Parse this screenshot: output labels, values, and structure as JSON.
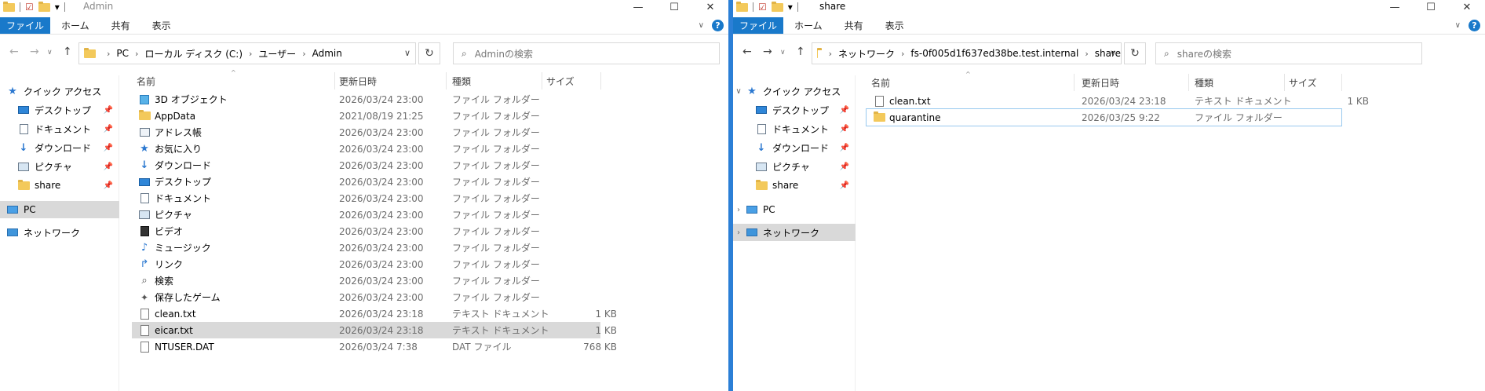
{
  "left": {
    "title": "Admin",
    "ribbon": {
      "file": "ファイル",
      "home": "ホーム",
      "share": "共有",
      "view": "表示"
    },
    "address": [
      "PC",
      "ローカル ディスク (C:)",
      "ユーザー",
      "Admin"
    ],
    "search_placeholder": "Adminの検索",
    "nav": [
      {
        "label": "クイック アクセス",
        "icon": "star-icon"
      },
      {
        "label": "デスクトップ",
        "icon": "desktop-icon",
        "pinned": true
      },
      {
        "label": "ドキュメント",
        "icon": "document-icon",
        "pinned": true
      },
      {
        "label": "ダウンロード",
        "icon": "download-icon",
        "pinned": true
      },
      {
        "label": "ピクチャ",
        "icon": "picture-icon",
        "pinned": true
      },
      {
        "label": "share",
        "icon": "folder-icon",
        "pinned": true
      },
      {
        "label": "PC",
        "icon": "pc-icon",
        "selected": true
      },
      {
        "label": "ネットワーク",
        "icon": "network-icon"
      }
    ],
    "columns": {
      "name": "名前",
      "date": "更新日時",
      "type": "種類",
      "size": "サイズ"
    },
    "files": [
      {
        "name": "3D オブジェクト",
        "date": "2026/03/24 23:00",
        "type": "ファイル フォルダー",
        "size": "",
        "icon": "cube-icon"
      },
      {
        "name": "AppData",
        "date": "2021/08/19 21:25",
        "type": "ファイル フォルダー",
        "size": "",
        "icon": "folder-icon"
      },
      {
        "name": "アドレス帳",
        "date": "2026/03/24 23:00",
        "type": "ファイル フォルダー",
        "size": "",
        "icon": "contacts-icon"
      },
      {
        "name": "お気に入り",
        "date": "2026/03/24 23:00",
        "type": "ファイル フォルダー",
        "size": "",
        "icon": "star-icon"
      },
      {
        "name": "ダウンロード",
        "date": "2026/03/24 23:00",
        "type": "ファイル フォルダー",
        "size": "",
        "icon": "download-icon"
      },
      {
        "name": "デスクトップ",
        "date": "2026/03/24 23:00",
        "type": "ファイル フォルダー",
        "size": "",
        "icon": "desktop-icon"
      },
      {
        "name": "ドキュメント",
        "date": "2026/03/24 23:00",
        "type": "ファイル フォルダー",
        "size": "",
        "icon": "document-icon"
      },
      {
        "name": "ピクチャ",
        "date": "2026/03/24 23:00",
        "type": "ファイル フォルダー",
        "size": "",
        "icon": "picture-icon"
      },
      {
        "name": "ビデオ",
        "date": "2026/03/24 23:00",
        "type": "ファイル フォルダー",
        "size": "",
        "icon": "video-icon"
      },
      {
        "name": "ミュージック",
        "date": "2026/03/24 23:00",
        "type": "ファイル フォルダー",
        "size": "",
        "icon": "music-icon"
      },
      {
        "name": "リンク",
        "date": "2026/03/24 23:00",
        "type": "ファイル フォルダー",
        "size": "",
        "icon": "link-icon"
      },
      {
        "name": "検索",
        "date": "2026/03/24 23:00",
        "type": "ファイル フォルダー",
        "size": "",
        "icon": "search-icon"
      },
      {
        "name": "保存したゲーム",
        "date": "2026/03/24 23:00",
        "type": "ファイル フォルダー",
        "size": "",
        "icon": "game-icon"
      },
      {
        "name": "clean.txt",
        "date": "2026/03/24 23:18",
        "type": "テキスト ドキュメント",
        "size": "1 KB",
        "icon": "text-file-icon"
      },
      {
        "name": "eicar.txt",
        "date": "2026/03/24 23:18",
        "type": "テキスト ドキュメント",
        "size": "1 KB",
        "icon": "text-file-icon",
        "selected": true
      },
      {
        "name": "NTUSER.DAT",
        "date": "2026/03/24 7:38",
        "type": "DAT ファイル",
        "size": "768 KB",
        "icon": "file-icon"
      }
    ]
  },
  "right": {
    "title": "share",
    "ribbon": {
      "file": "ファイル",
      "home": "ホーム",
      "share": "共有",
      "view": "表示"
    },
    "address": [
      "ネットワーク",
      "fs-0f005d1f637ed38be.test.internal",
      "share"
    ],
    "search_placeholder": "shareの検索",
    "nav": [
      {
        "label": "クイック アクセス",
        "icon": "star-icon",
        "expand": "v"
      },
      {
        "label": "デスクトップ",
        "icon": "desktop-icon",
        "pinned": true
      },
      {
        "label": "ドキュメント",
        "icon": "document-icon",
        "pinned": true
      },
      {
        "label": "ダウンロード",
        "icon": "download-icon",
        "pinned": true
      },
      {
        "label": "ピクチャ",
        "icon": "picture-icon",
        "pinned": true
      },
      {
        "label": "share",
        "icon": "folder-icon",
        "pinned": true
      },
      {
        "label": "PC",
        "icon": "pc-icon",
        "expand": ">"
      },
      {
        "label": "ネットワーク",
        "icon": "network-icon",
        "expand": ">",
        "selected": true
      }
    ],
    "columns": {
      "name": "名前",
      "date": "更新日時",
      "type": "種類",
      "size": "サイズ"
    },
    "files": [
      {
        "name": "clean.txt",
        "date": "2026/03/24 23:18",
        "type": "テキスト ドキュメント",
        "size": "1 KB",
        "icon": "text-file-icon"
      },
      {
        "name": "quarantine",
        "date": "2026/03/25 9:22",
        "type": "ファイル フォルダー",
        "size": "",
        "icon": "folder-icon",
        "focused": true
      }
    ]
  }
}
